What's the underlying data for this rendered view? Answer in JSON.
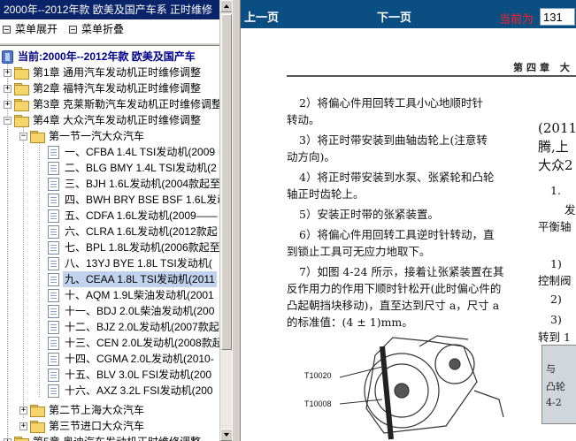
{
  "left_pane": {
    "title": "2000年--2012年款 欧美及国产车系 正时维修",
    "toolbar": {
      "expand_label": "菜单展开",
      "collapse_label": "菜单折叠"
    },
    "tree": {
      "root_label": "当前:2000年--2012年款 欧美及国产车",
      "chapters": [
        {
          "expander": "+",
          "label": "第1章 通用汽车发动机正时维修调整"
        },
        {
          "expander": "+",
          "label": "第2章 福特汽车发动机正时维修调整"
        },
        {
          "expander": "+",
          "label": "第3章 克莱斯勒汽车发动机正时维修调整"
        },
        {
          "expander": "−",
          "label": "第4章 大众汽车发动机正时维修调整"
        }
      ],
      "section_1": {
        "expander": "−",
        "label": "第一节一汽大众汽车"
      },
      "items": [
        "一、CFBA 1.4L TSI发动机(2009",
        "二、BLG BMY 1.4L TSI发动机(2",
        "三、BJH 1.6L发动机(2004款起至",
        "四、BWH BRY BSE BSF 1.6L发动",
        "五、CDFA 1.6L发动机(2009——",
        "六、CLRA 1.6L发动机(2012款起",
        "七、BPL 1.8L发动机(2006款起至",
        "八、13YJ BYE 1.8L TSI发动机(",
        "九、CEAA 1.8L TSI发动机(2011",
        "十、AQM 1.9L柴油发动机(2001",
        "十一、BDJ 2.0L柴油发动机(200",
        "十二、BJZ 2.0L发动机(2007款起",
        "十三、CEN 2.0L发动机(2008款起",
        "十四、CGMA 2.0L发动机(2010-",
        "十五、BLV 3.0L FSI发动机(200",
        "十六、AXZ 3.2L FSI发动机(200"
      ],
      "selected_index": 8,
      "section_2": {
        "expander": "+",
        "label": "第二节上海大众汽车"
      },
      "section_3": {
        "expander": "+",
        "label": "第三节进口大众汽车"
      },
      "chapter_5": {
        "expander": "+",
        "label": "第5章 奥迪汽车发动机正时维修调整"
      }
    }
  },
  "viewer": {
    "prev_label": "上一页",
    "next_label": "下一页",
    "current_label": "当前为",
    "current_page": "131"
  },
  "page": {
    "chapter_header": "第四章  大",
    "left_column": [
      "2）将偏心件用回转工具小心地顺时针",
      "转动。",
      "3）将正时带安装到曲轴齿轮上(注意转",
      "动方向)。",
      "4）将正时带安装到水泵、张紧轮和凸轮",
      "轴正时齿轮上。",
      "5）安装正时带的张紧装置。",
      "6）将偏心件用回转工具逆时针转动，直",
      "到锁止工具可无应力地取下。",
      "7）如图 4-24 所示，接着让张紧装置在其",
      "反作用力的作用下顺时针松开(此时偏心件的",
      "凸起朝挡块移动)，直至达到尺寸 a，尺寸 a",
      "的标准值：(4 ± 1)mm。"
    ],
    "right_column": [
      "(2011",
      "腾,上",
      "大众2",
      "1.",
      "发",
      "平衡轴",
      "1)",
      "控制阀",
      "2)",
      "3)",
      "转到 1"
    ],
    "figure_labels": [
      "T10020",
      "T10008"
    ],
    "inset_lines": [
      "与",
      "凸轮",
      "4-2"
    ]
  }
}
